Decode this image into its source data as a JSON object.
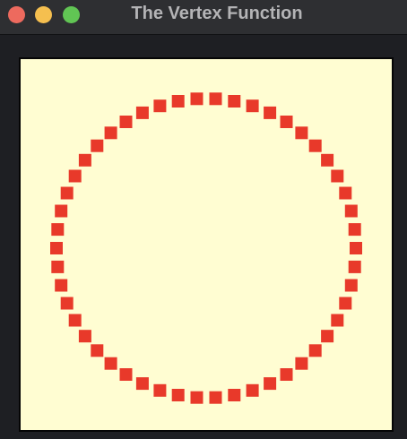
{
  "window": {
    "title": "The Vertex Function"
  },
  "colors": {
    "background": "#fffdd2",
    "vertex": "#e8392a",
    "window_chrome": "#2e2f32",
    "title_text": "#b4b4b6",
    "close": "#ed6a5e",
    "minimize": "#f5bf4f",
    "maximize": "#61c554"
  },
  "render": {
    "primitive": "square-points",
    "vertex_count": 50,
    "shape": "circle"
  }
}
